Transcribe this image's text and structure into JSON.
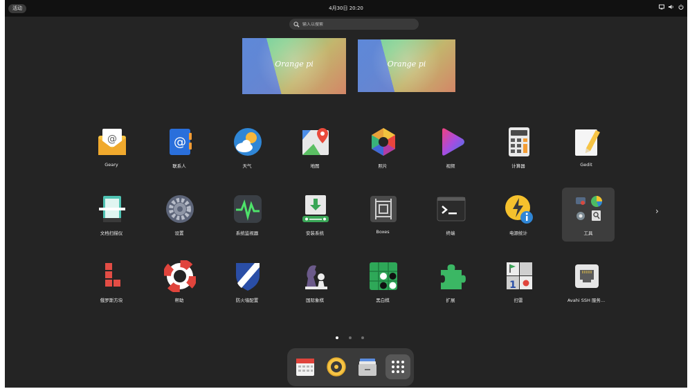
{
  "topbar": {
    "activities_label": "活动",
    "clock": "4月30日  20:20",
    "tray": [
      {
        "icon": "screen-icon"
      },
      {
        "icon": "volume-icon"
      },
      {
        "icon": "power-icon"
      }
    ]
  },
  "search": {
    "placeholder": "输入以搜索"
  },
  "workspaces": [
    {
      "logo": "Orange pi"
    },
    {
      "logo": "Orange pi"
    }
  ],
  "app_grid": {
    "rows": [
      [
        {
          "label": "Geary",
          "icon": "mail-envelope-icon"
        },
        {
          "label": "联系人",
          "icon": "contacts-at-icon"
        },
        {
          "label": "天气",
          "icon": "weather-icon"
        },
        {
          "label": "地图",
          "icon": "maps-icon"
        },
        {
          "label": "照片",
          "icon": "photos-icon"
        },
        {
          "label": "视频",
          "icon": "video-play-icon"
        },
        {
          "label": "计算器",
          "icon": "calculator-icon"
        },
        {
          "label": "Gedit",
          "icon": "text-editor-icon"
        }
      ],
      [
        {
          "label": "文档扫描仪",
          "icon": "scanner-icon"
        },
        {
          "label": "设置",
          "icon": "settings-gear-icon"
        },
        {
          "label": "系统监视器",
          "icon": "system-monitor-icon"
        },
        {
          "label": "安装系统",
          "icon": "install-system-icon"
        },
        {
          "label": "Boxes",
          "icon": "boxes-icon"
        },
        {
          "label": "终端",
          "icon": "terminal-icon"
        },
        {
          "label": "电源统计",
          "icon": "power-statistics-icon"
        },
        {
          "label": "工具",
          "icon": "utilities-folder-icon"
        }
      ],
      [
        {
          "label": "俄罗斯方块",
          "icon": "tetris-icon"
        },
        {
          "label": "帮助",
          "icon": "help-lifebuoy-icon"
        },
        {
          "label": "防火墙配置",
          "icon": "firewall-shield-icon"
        },
        {
          "label": "国际象棋",
          "icon": "chess-icon"
        },
        {
          "label": "黑白棋",
          "icon": "reversi-icon"
        },
        {
          "label": "扩展",
          "icon": "extensions-puzzle-icon"
        },
        {
          "label": "扫雷",
          "icon": "minesweeper-icon"
        },
        {
          "label": "Avahi SSH 服务...",
          "icon": "ssh-server-icon"
        }
      ]
    ],
    "selected": "工具",
    "next_page_glyph": "›"
  },
  "page_indicator": {
    "pages": 3,
    "current": 1
  },
  "dash": {
    "items": [
      {
        "icon": "calendar-icon"
      },
      {
        "icon": "rhythmbox-icon"
      },
      {
        "icon": "files-icon"
      },
      {
        "icon": "show-apps-grid-icon"
      }
    ]
  },
  "colors": {
    "background": "#242424",
    "topbar": "#111111",
    "selected_tile": "#3d3d3d",
    "dash": "#3a3a3a"
  }
}
